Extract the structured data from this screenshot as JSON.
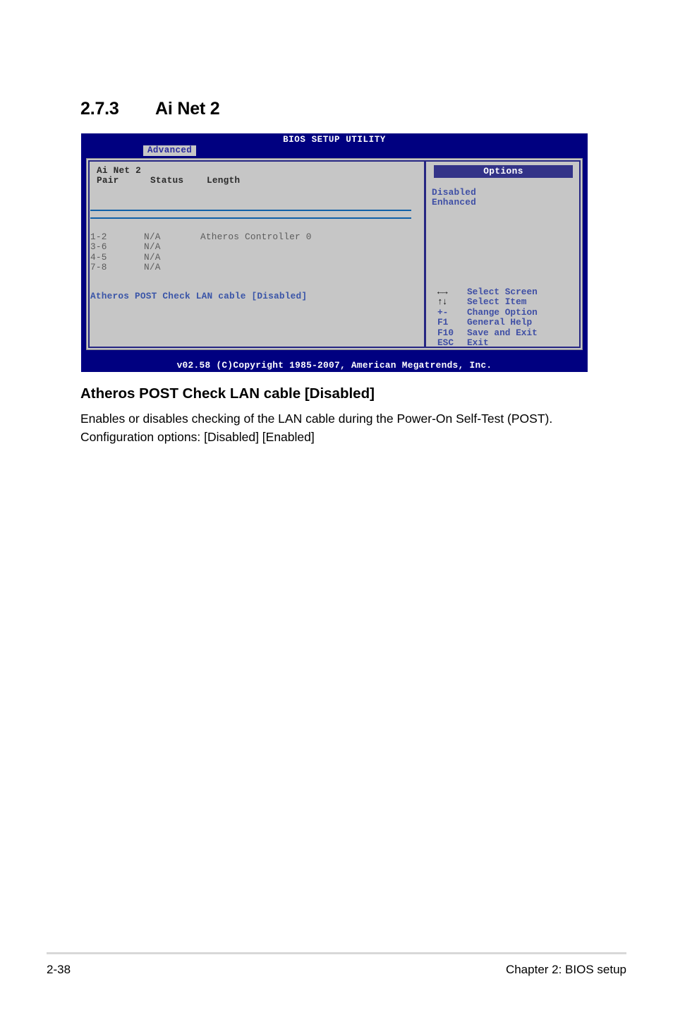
{
  "section": {
    "number": "2.7.3",
    "title": "Ai Net 2"
  },
  "bios": {
    "title": "BIOS SETUP UTILITY",
    "active_tab": "Advanced",
    "left_pane": {
      "group_title": "Ai Net 2",
      "columns": [
        "Pair",
        "Status",
        "Length"
      ],
      "rows": [
        {
          "pair": "1-2",
          "status": "N/A",
          "length": "Atheros Controller 0"
        },
        {
          "pair": "3-6",
          "status": "N/A",
          "length": ""
        },
        {
          "pair": "4-5",
          "status": "N/A",
          "length": ""
        },
        {
          "pair": "7-8",
          "status": "N/A",
          "length": ""
        }
      ],
      "setting_label": "Atheros POST Check LAN cable",
      "setting_value": "[Disabled]"
    },
    "right_pane": {
      "options_header": "Options",
      "options": [
        "Disabled",
        "Enhanced"
      ],
      "legend": [
        {
          "key": "←→",
          "desc": "Select Screen",
          "glyph": true
        },
        {
          "key": "↑↓",
          "desc": "Select Item",
          "glyph": true
        },
        {
          "key": "+-",
          "desc": "Change Option",
          "glyph": false
        },
        {
          "key": "F1",
          "desc": "General Help",
          "glyph": false
        },
        {
          "key": "F10",
          "desc": "Save and Exit",
          "glyph": false
        },
        {
          "key": "ESC",
          "desc": "Exit",
          "glyph": false
        }
      ]
    },
    "copyright": "v02.58 (C)Copyright 1985-2007, American Megatrends, Inc.",
    "colors": {
      "chrome_blue": "#000080",
      "panel_grey": "#c6c6c6",
      "options_bar": "#333388",
      "rule_blue": "#1060a8",
      "text_blue": "#3f4fa5"
    }
  },
  "item": {
    "title": "Atheros POST Check LAN cable [Disabled]",
    "description": "Enables or disables checking of the LAN cable during the Power-On Self-Test (POST). Configuration options: [Disabled] [Enabled]"
  },
  "footer": {
    "page_number": "2-38",
    "chapter": "Chapter 2: BIOS setup"
  }
}
